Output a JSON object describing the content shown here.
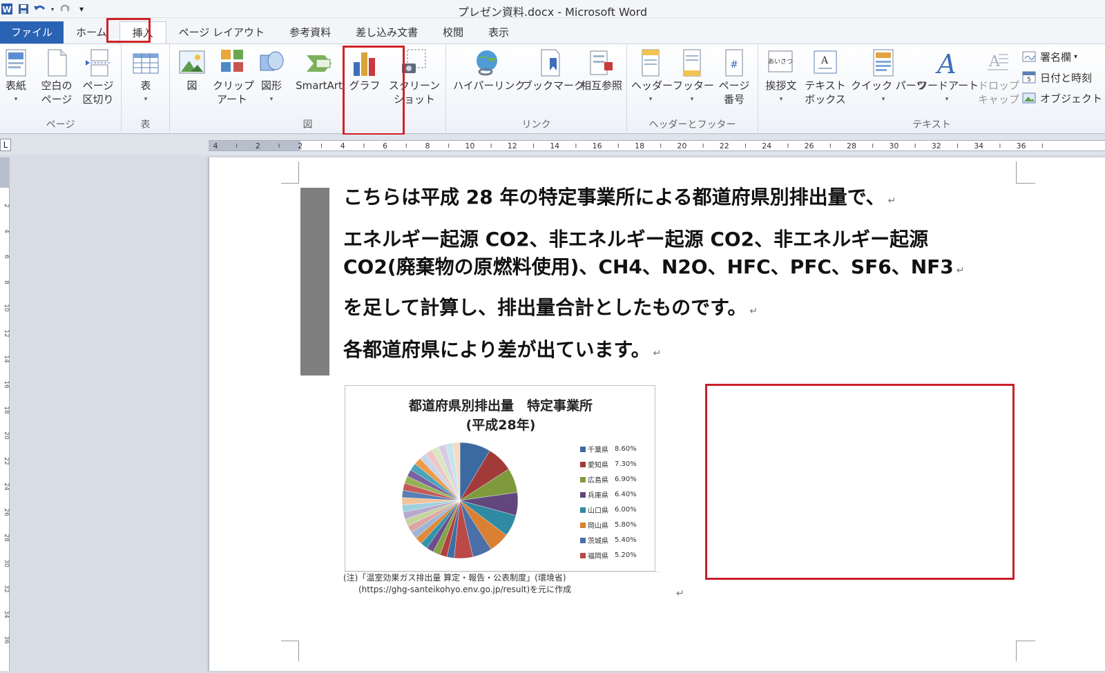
{
  "window": {
    "title": "プレゼン資料.docx - Microsoft Word"
  },
  "qat": {
    "icons": [
      "word-logo-icon",
      "save-icon",
      "undo-icon",
      "redo-icon",
      "customize-qat-icon"
    ]
  },
  "tabs": [
    {
      "label": "ファイル"
    },
    {
      "label": "ホーム"
    },
    {
      "label": "挿入"
    },
    {
      "label": "ページ レイアウト"
    },
    {
      "label": "参考資料"
    },
    {
      "label": "差し込み文書"
    },
    {
      "label": "校閲"
    },
    {
      "label": "表示"
    }
  ],
  "ribbon": {
    "groups": {
      "pages": "ページ",
      "tables": "表",
      "illustrations": "図",
      "links": "リンク",
      "header_footer": "ヘッダーとフッター",
      "text": "テキスト"
    },
    "buttons": {
      "cover": "表紙",
      "blank_page": "空白の\nページ",
      "page_break": "ページ\n区切り",
      "table": "表",
      "picture": "図",
      "clipart": "クリップ\nアート",
      "shapes": "図形",
      "smartart": "SmartArt",
      "chart": "グラフ",
      "screenshot": "スクリーン\nショット",
      "hyperlink": "ハイパーリンク",
      "bookmark": "ブックマーク",
      "crossref": "相互参照",
      "header": "ヘッダー",
      "footer": "フッター",
      "page_number": "ページ\n番号",
      "greeting": "挨拶文",
      "textbox": "テキスト\nボックス",
      "quickparts": "クイック パーツ",
      "wordart": "ワードアート",
      "dropcap": "ドロップ\nキャップ"
    },
    "small": {
      "signature": "署名欄",
      "datetime": "日付と時刻",
      "object": "オブジェクト"
    }
  },
  "ruler": {
    "corner": "L",
    "labels": [
      "4",
      "2",
      "2",
      "4",
      "6",
      "8",
      "10",
      "12",
      "14",
      "16",
      "18",
      "20",
      "22",
      "24",
      "26",
      "28",
      "30",
      "32",
      "34",
      "36"
    ],
    "vlabels": [
      "2",
      "4",
      "6",
      "8",
      "10",
      "12",
      "14",
      "16",
      "18",
      "20",
      "22",
      "24",
      "26",
      "28",
      "30",
      "32",
      "34",
      "36"
    ]
  },
  "document": {
    "paragraphs": [
      "こちらは平成 28 年の特定事業所による都道府県別排出量で、",
      "エネルギー起源 CO2、非エネルギー起源 CO2、非エネルギー起源",
      "CO2(廃棄物の原燃料使用)、CH4、N2O、HFC、PFC、SF6、NF3",
      "を足して計算し、排出量合計としたものです。",
      "各都道府県により差が出ています。"
    ],
    "paragraph_mark": "↵",
    "note_line1": "(注)「温室効果ガス排出量 算定・報告・公表制度」(環境省)",
    "note_line2": "(https://ghg-santeikohyo.env.go.jp/result)を元に作成"
  },
  "chart_data": {
    "type": "pie",
    "title": "都道府県別排出量　特定事業所",
    "subtitle": "(平成28年)",
    "legend_position": "right",
    "labels": [
      "千葉県",
      "愛知県",
      "広島県",
      "兵庫県",
      "山口県",
      "岡山県",
      "茨城県",
      "福岡県"
    ],
    "values": [
      8.6,
      7.3,
      6.9,
      6.4,
      6.0,
      5.8,
      5.4,
      5.2
    ],
    "value_labels": [
      "8.60%",
      "7.30%",
      "6.90%",
      "6.40%",
      "6.00%",
      "5.80%",
      "5.40%",
      "5.20%"
    ],
    "colors": [
      "#3b6aa0",
      "#a33a3a",
      "#7f9a3c",
      "#62477f",
      "#2f8aa3",
      "#d98033",
      "#4b6fa8",
      "#b94a48"
    ],
    "other_slice_colors": [
      "#3e6ea6",
      "#b3403d",
      "#86a243",
      "#6b4f8c",
      "#3294ad",
      "#e08936",
      "#9fb5d6",
      "#dca6a4",
      "#c3d49c",
      "#b7a9cd",
      "#9fd0dd",
      "#f2c39b",
      "#5a7fb4",
      "#c45b58",
      "#95b157",
      "#7a62a0",
      "#48a5bd",
      "#f09a4a",
      "#c9d6ea",
      "#edc6c5",
      "#dbe6c2",
      "#d6cce4",
      "#c5e5ed",
      "#f8dbc2"
    ]
  },
  "accent_colors": {
    "highlight_box": "#d02027",
    "file_tab": "#2a62b4"
  }
}
